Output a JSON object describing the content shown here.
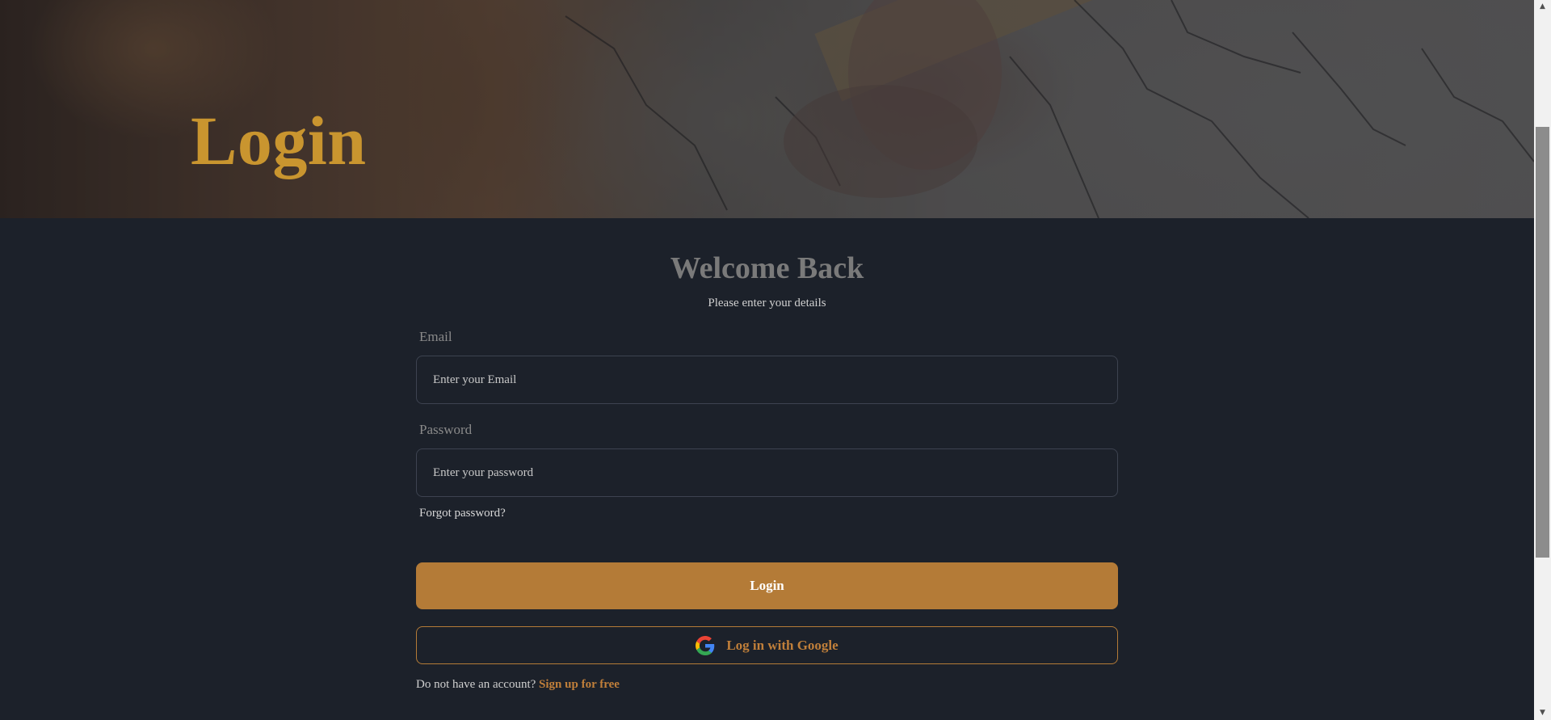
{
  "hero": {
    "title": "Login",
    "title_color": "#c9952f"
  },
  "form": {
    "heading": "Welcome Back",
    "subtitle": "Please enter your details",
    "email": {
      "label": "Email",
      "placeholder": "Enter your Email",
      "value": ""
    },
    "password": {
      "label": "Password",
      "placeholder": "Enter your password",
      "value": ""
    },
    "forgot_password": "Forgot password?",
    "login_button": "Login",
    "google_button": "Log in with Google",
    "google_icon": "google-g-icon",
    "signup_prompt": "Do not have an account?",
    "signup_link": "Sign up for free"
  },
  "colors": {
    "background": "#1c212a",
    "accent": "#b47b37",
    "accent_text": "#c07f3a"
  },
  "scrollbar": {
    "up_icon": "triangle-up-icon",
    "down_icon": "triangle-down-icon"
  }
}
